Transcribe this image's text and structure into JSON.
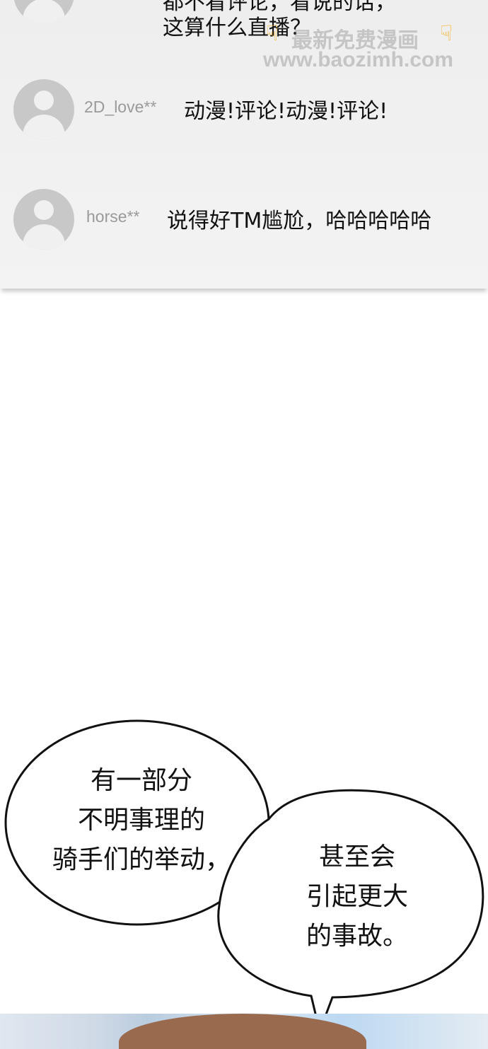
{
  "comments": [
    {
      "username": "",
      "text_line1": "都不看评论，看说的话，",
      "text_line2": "这算什么直播？"
    },
    {
      "username": "2D_love**",
      "text": "动漫!评论!动漫!评论!"
    },
    {
      "username": "horse**",
      "text": "说得好TM尴尬，哈哈哈哈哈"
    }
  ],
  "watermark": {
    "title": "最新免费漫画",
    "url": "www.baozimh.com",
    "icon": "pointing-down-hand-icon"
  },
  "speech_bubbles": [
    {
      "lines": [
        "有一部分",
        "不明事理的",
        "骑手们的举动，"
      ]
    },
    {
      "lines": [
        "甚至会",
        "引起更大",
        "的事故。"
      ]
    }
  ],
  "colors": {
    "panel_bg": "#f0f0f0",
    "avatar": "#c8c8c8",
    "username": "#9a9a9a",
    "text": "#111111"
  }
}
